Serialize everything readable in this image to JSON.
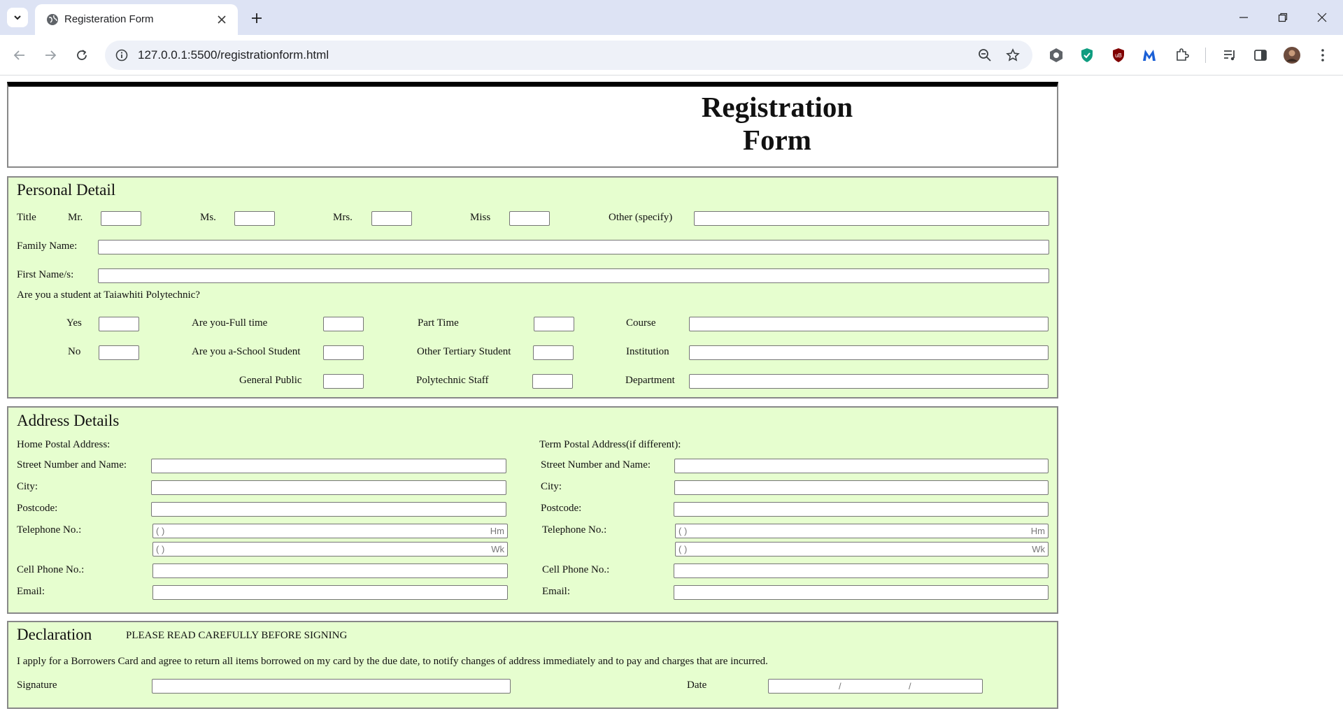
{
  "browser": {
    "tab_title": "Registeration Form",
    "url": "127.0.0.1:5500/registrationform.html"
  },
  "header": {
    "title_line1": "Registration",
    "title_line2": "Form"
  },
  "personal": {
    "heading": "Personal Detail",
    "title_label": "Title",
    "mr": "Mr.",
    "ms": "Ms.",
    "mrs": "Mrs.",
    "miss": "Miss",
    "other": "Other (specify)",
    "family_name": "Family Name:",
    "first_names": "First Name/s:",
    "student_question": "Are you a student at Taiawhiti Polytechnic?",
    "yes": "Yes",
    "no": "No",
    "full_time": "Are you-Full time",
    "school_student": "Are you a-School Student",
    "general_public": "General Public",
    "part_time": "Part Time",
    "other_tertiary": "Other Tertiary Student",
    "poly_staff": "Polytechnic Staff",
    "course": "Course",
    "institution": "Institution",
    "department": "Department"
  },
  "address": {
    "heading": "Address Details",
    "home_heading": "Home Postal Address:",
    "term_heading": "Term Postal Address(if different):",
    "street": "Street Number and Name:",
    "city": "City:",
    "postcode": "Postcode:",
    "telephone": "Telephone No.:",
    "cell": "Cell Phone No.:",
    "email": "Email:",
    "phone_prefix": "(   )",
    "home_suffix": "Hm",
    "work_suffix": "Wk"
  },
  "declaration": {
    "heading": "Declaration",
    "notice": "PLEASE READ CAREFULLY BEFORE SIGNING",
    "statement": "I apply for a Borrowers Card and agree to return all items borrowed on my card by the due date, to notify changes of address immediately and to pay and charges that are incurred.",
    "signature": "Signature",
    "date": "Date",
    "date_sep": "/"
  }
}
